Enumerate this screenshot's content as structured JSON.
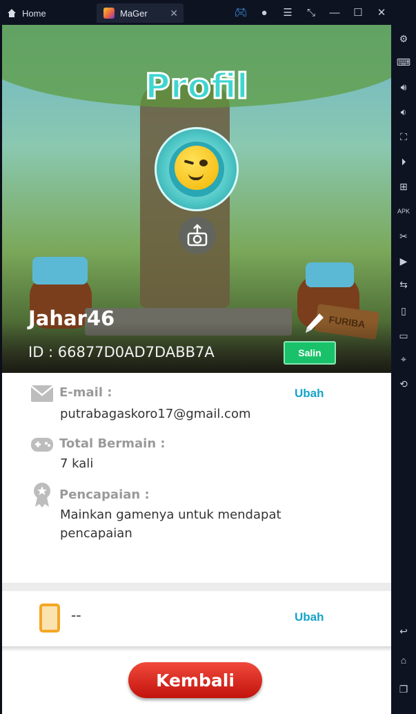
{
  "window": {
    "home_tab": "Home",
    "app_tab": "MaGer"
  },
  "profile": {
    "title": "Profil",
    "username": "Jahar46",
    "id_text": "ID : 66877D0AD7DABB7A",
    "copy_label": "Salin",
    "sign_text": "FURIBA"
  },
  "info": {
    "email_label": "E-mail :",
    "email_value": "putrabagaskoro17@gmail.com",
    "email_action": "Ubah",
    "plays_label": "Total Bermain :",
    "plays_value": "7 kali",
    "achievement_label": "Pencapaian :",
    "achievement_value": "Mainkan gamenya untuk mendapat pencapaian"
  },
  "phone": {
    "value": "--",
    "action": "Ubah"
  },
  "back_label": "Kembali",
  "colors": {
    "accent": "#14a3c9",
    "copy_button": "#19c26a",
    "back_button": "#d8231b"
  }
}
